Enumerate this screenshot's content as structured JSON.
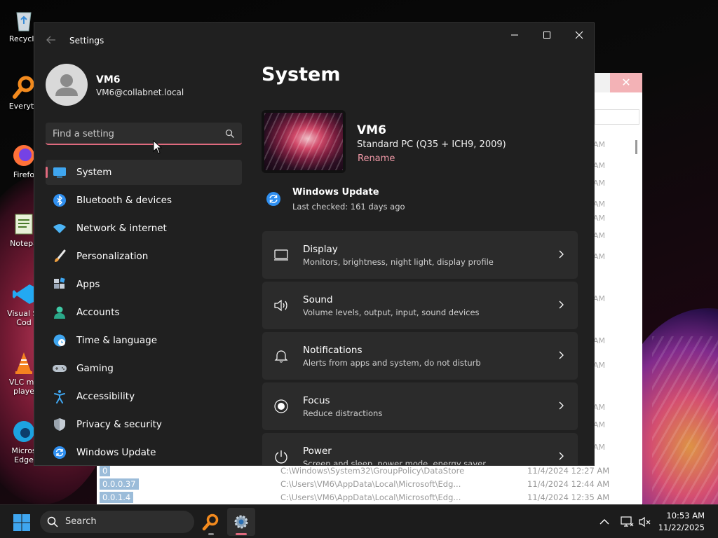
{
  "desktop": {
    "icons": [
      {
        "label": "Recycle"
      },
      {
        "label": "Everyth"
      },
      {
        "label": "Firefo"
      },
      {
        "label": "Notepa"
      },
      {
        "label": "Visual St\nCod"
      },
      {
        "label": "VLC me\nplaye"
      },
      {
        "label": "Micros\nEdge"
      }
    ]
  },
  "background_window": {
    "times": [
      "AM",
      "AM",
      "AM",
      "AM",
      "AM",
      "AM",
      "AM",
      "AM",
      "AM",
      "AM",
      "AM",
      "AM",
      "AM"
    ],
    "rows": [
      {
        "name": "0",
        "path": "C:\\Windows\\System32\\GroupPolicy\\DataStore",
        "date": "11/4/2024 12:27 AM"
      },
      {
        "name": "0.0.0.37",
        "path": "C:\\Users\\VM6\\AppData\\Local\\Microsoft\\Edg...",
        "date": "11/4/2024 12:44 AM"
      },
      {
        "name": "0.0.1.4",
        "path": "C:\\Users\\VM6\\AppData\\Local\\Microsoft\\Edg...",
        "date": "11/4/2024 12:35 AM"
      }
    ]
  },
  "settings": {
    "app_title": "Settings",
    "user": {
      "name": "VM6",
      "email": "VM6@collabnet.local"
    },
    "search": {
      "placeholder": "Find a setting"
    },
    "nav": [
      {
        "label": "System",
        "icon": "monitor-icon",
        "active": true
      },
      {
        "label": "Bluetooth & devices",
        "icon": "bluetooth-icon"
      },
      {
        "label": "Network & internet",
        "icon": "wifi-icon"
      },
      {
        "label": "Personalization",
        "icon": "brush-icon"
      },
      {
        "label": "Apps",
        "icon": "apps-icon"
      },
      {
        "label": "Accounts",
        "icon": "person-icon"
      },
      {
        "label": "Time & language",
        "icon": "globe-clock-icon"
      },
      {
        "label": "Gaming",
        "icon": "gamepad-icon"
      },
      {
        "label": "Accessibility",
        "icon": "accessibility-icon"
      },
      {
        "label": "Privacy & security",
        "icon": "shield-icon"
      },
      {
        "label": "Windows Update",
        "icon": "update-icon"
      }
    ],
    "page_title": "System",
    "device": {
      "name": "VM6",
      "model": "Standard PC (Q35 + ICH9, 2009)",
      "rename_label": "Rename"
    },
    "windows_update": {
      "title": "Windows Update",
      "status": "Last checked: 161 days ago"
    },
    "cards": [
      {
        "title": "Display",
        "subtitle": "Monitors, brightness, night light, display profile",
        "icon": "display-icon"
      },
      {
        "title": "Sound",
        "subtitle": "Volume levels, output, input, sound devices",
        "icon": "speaker-icon"
      },
      {
        "title": "Notifications",
        "subtitle": "Alerts from apps and system, do not disturb",
        "icon": "bell-icon"
      },
      {
        "title": "Focus",
        "subtitle": "Reduce distractions",
        "icon": "focus-icon"
      },
      {
        "title": "Power",
        "subtitle": "Screen and sleep, power mode, energy saver",
        "icon": "power-icon"
      }
    ],
    "accent_color": "#e06a7e"
  },
  "taskbar": {
    "search_label": "Search",
    "time": "10:53 AM",
    "date": "11/22/2025"
  }
}
